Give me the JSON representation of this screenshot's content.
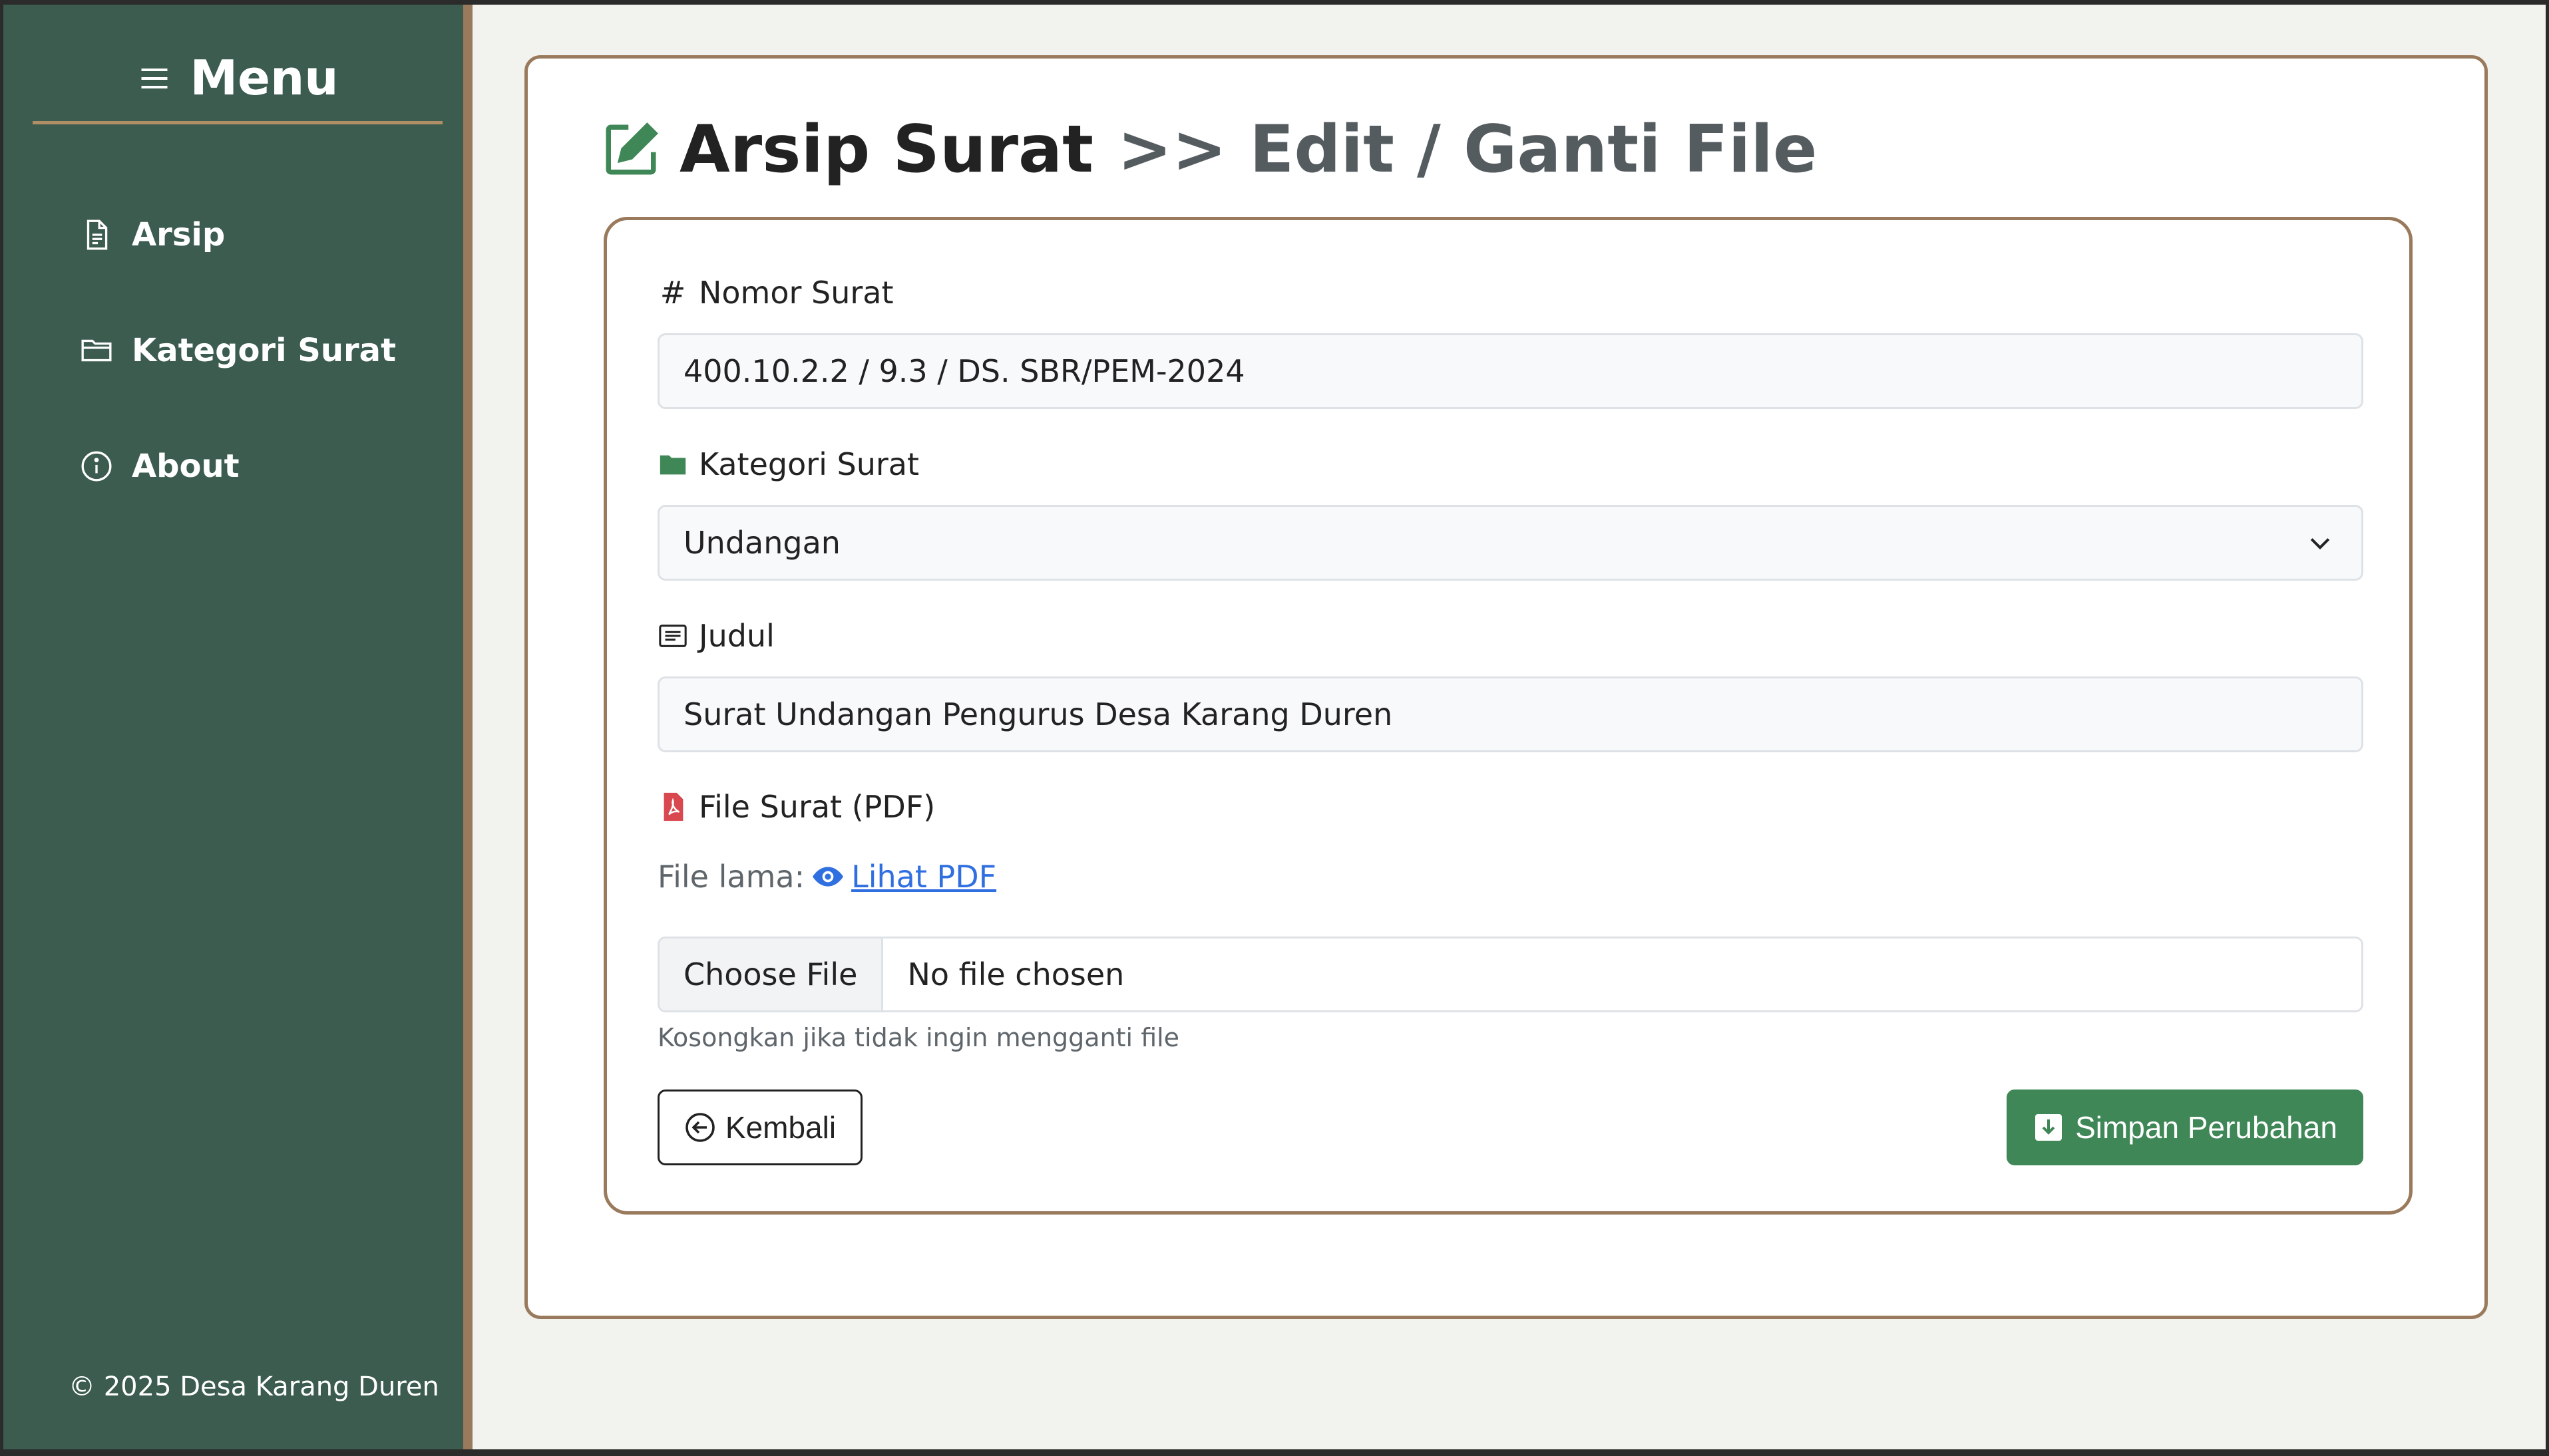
{
  "sidebar": {
    "title": "Menu",
    "items": [
      {
        "label": "Arsip",
        "icon": "file-text-icon"
      },
      {
        "label": "Kategori Surat",
        "icon": "folder-icon"
      },
      {
        "label": "About",
        "icon": "info-icon"
      }
    ],
    "footer": "© 2025 Desa Karang Duren"
  },
  "header": {
    "title": "Arsip Surat",
    "subtitle": ">> Edit / Ganti File"
  },
  "form": {
    "nomor_label": "Nomor Surat",
    "nomor_value": "400.10.2.2 / 9.3 / DS. SBR/PEM-2024",
    "kategori_label": "Kategori Surat",
    "kategori_value": "Undangan",
    "judul_label": "Judul",
    "judul_value": "Surat Undangan Pengurus Desa Karang Duren",
    "file_label": "File Surat (PDF)",
    "old_file_prefix": "File lama:",
    "old_file_link": " Lihat PDF",
    "choose_file": "Choose File",
    "no_file": "No file chosen",
    "hint": "Kosongkan jika tidak ingin mengganti file",
    "back_button": "Kembali",
    "save_button": "Simpan Perubahan"
  },
  "colors": {
    "sidebar_bg": "#3b5c4f",
    "accent_border": "#9a7a5c",
    "save_green": "#3f8756",
    "link_blue": "#2f6fe0",
    "pdf_red": "#d9474f",
    "folder_green": "#3f8756"
  }
}
